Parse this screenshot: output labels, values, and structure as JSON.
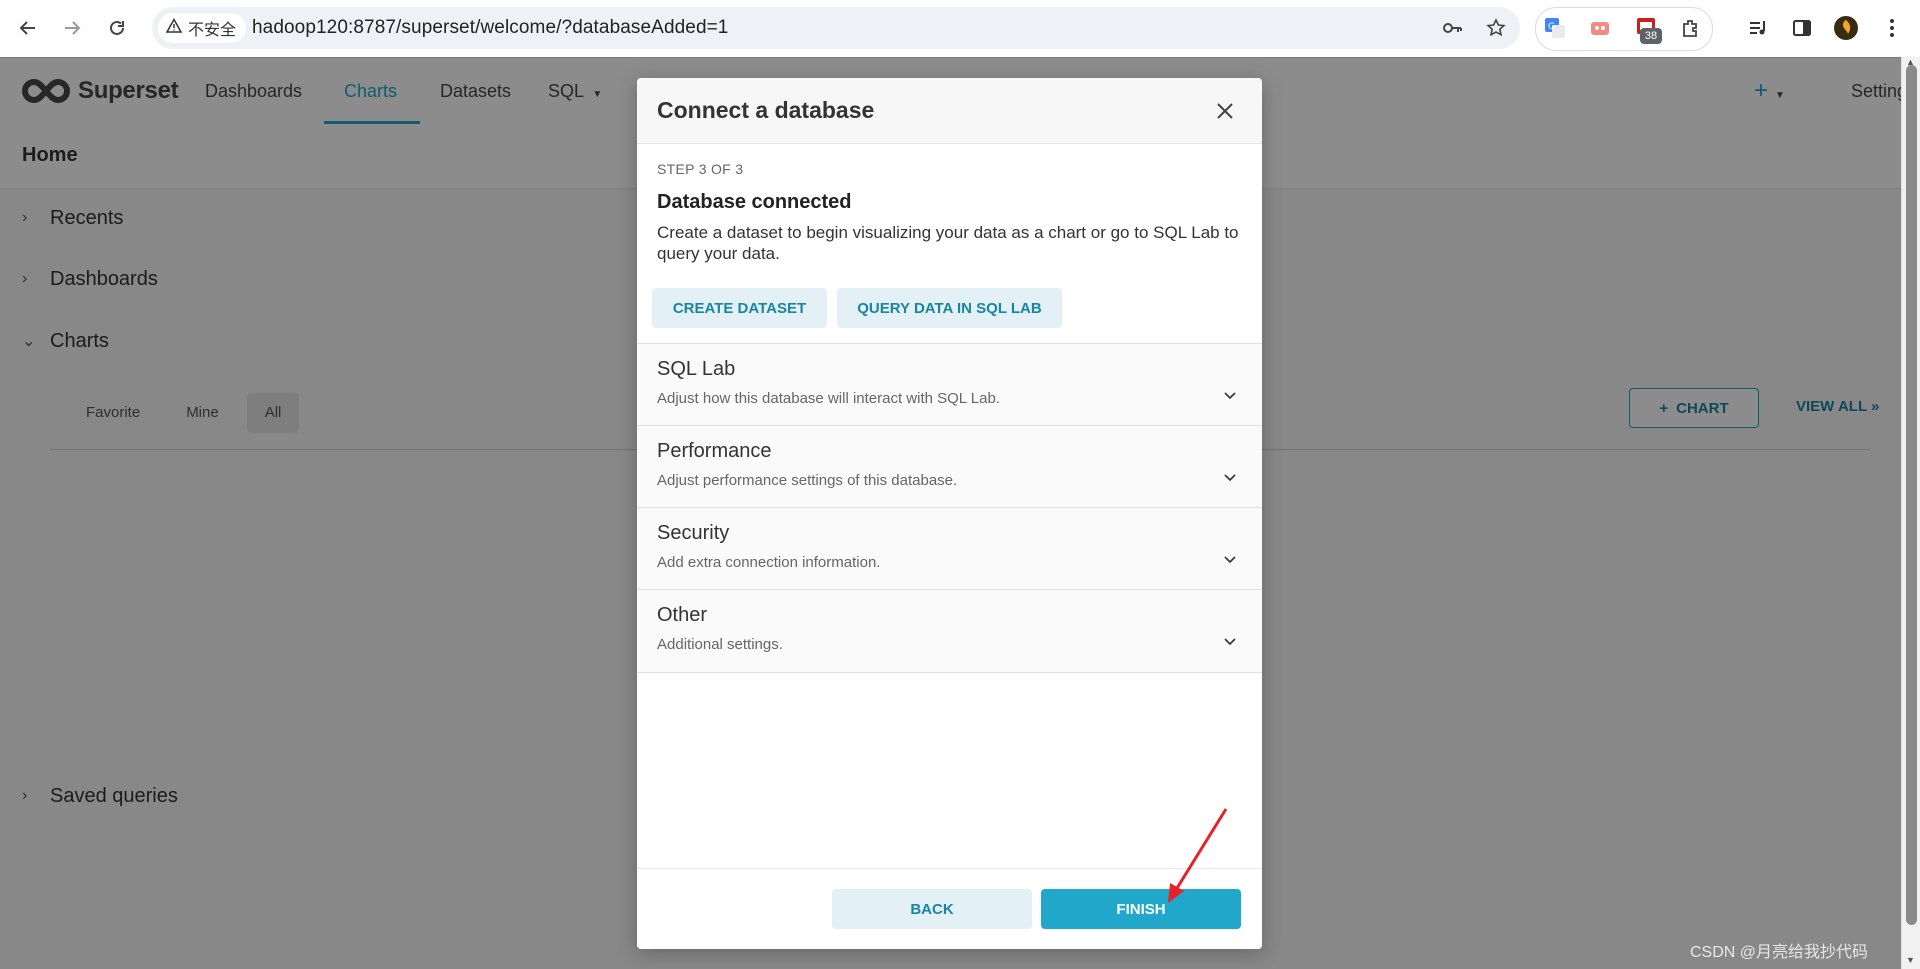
{
  "browser": {
    "security_label": "不安全",
    "url": "hadoop120:8787/superset/welcome/?databaseAdded=1",
    "extension_badge": "38"
  },
  "topnav": {
    "brand": "Superset",
    "menu": [
      "Dashboards",
      "Charts",
      "Datasets",
      "SQL"
    ],
    "settings_label": "Settings"
  },
  "home": {
    "title": "Home",
    "sections": {
      "recents": "Recents",
      "dashboards": "Dashboards",
      "charts": "Charts",
      "saved_queries": "Saved queries"
    },
    "filter_tabs": [
      "Favorite",
      "Mine",
      "All"
    ],
    "add_chart_label": "CHART",
    "view_all_label": "VIEW ALL »"
  },
  "modal": {
    "title": "Connect a database",
    "step": "STEP 3 OF 3",
    "status_title": "Database connected",
    "description": "Create a dataset to begin visualizing your data as a chart or go to SQL Lab to query your data.",
    "create_dataset_label": "CREATE DATASET",
    "query_sql_lab_label": "QUERY DATA IN SQL LAB",
    "panels": [
      {
        "title": "SQL Lab",
        "subtitle": "Adjust how this database will interact with SQL Lab."
      },
      {
        "title": "Performance",
        "subtitle": "Adjust performance settings of this database."
      },
      {
        "title": "Security",
        "subtitle": "Add extra connection information."
      },
      {
        "title": "Other",
        "subtitle": "Additional settings."
      }
    ],
    "back_label": "BACK",
    "finish_label": "FINISH"
  },
  "watermark": "CSDN @月亮给我抄代码",
  "colors": {
    "accent": "#20a7c9",
    "accent_dark": "#1985a0",
    "secondary_bg": "#e3f1f6",
    "annotation_arrow": "#e8202a"
  },
  "icons": [
    "back-arrow-icon",
    "forward-arrow-icon",
    "reload-icon",
    "warning-icon",
    "key-icon",
    "star-icon",
    "translate-icon",
    "extension-icon",
    "puzzle-icon",
    "media-icon",
    "sidepanel-icon",
    "profile-avatar-icon",
    "kebab-menu-icon",
    "plus-icon",
    "close-icon",
    "chevron-down-icon",
    "chevron-right-icon"
  ]
}
